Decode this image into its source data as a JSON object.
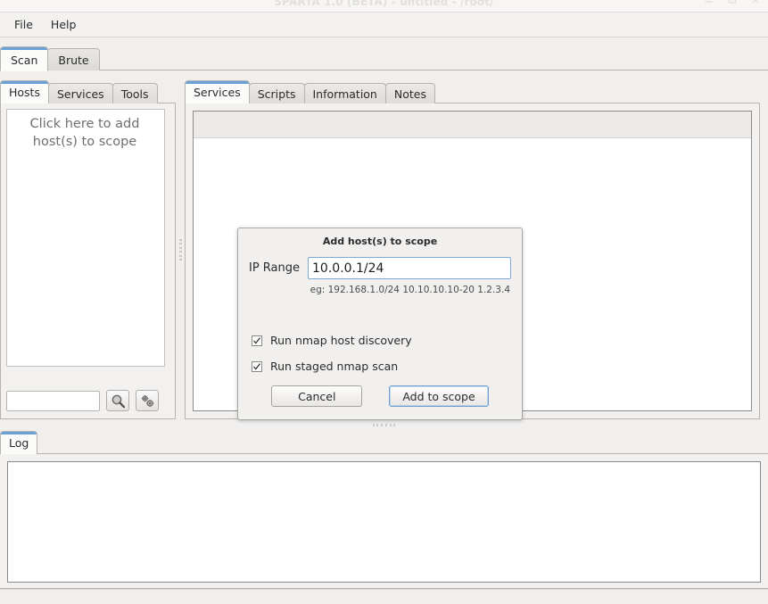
{
  "window": {
    "title": "SPARTA 1.0 (BETA) - untitled - /root/",
    "controls": {
      "minimize": "minimize-icon",
      "maximize": "maximize-icon",
      "close": "close-icon"
    }
  },
  "menubar": {
    "items": [
      {
        "label": "File"
      },
      {
        "label": "Help"
      }
    ]
  },
  "main_tabs": [
    {
      "label": "Scan",
      "active": true
    },
    {
      "label": "Brute",
      "active": false
    }
  ],
  "left_panel": {
    "tabs": [
      {
        "label": "Hosts",
        "active": true
      },
      {
        "label": "Services",
        "active": false
      },
      {
        "label": "Tools",
        "active": false
      }
    ],
    "host_list": {
      "placeholder_line1": "Click here to add",
      "placeholder_line2": "host(s) to scope",
      "items": []
    },
    "search": {
      "value": "",
      "placeholder": "",
      "search_button_icon": "magnifier-icon",
      "settings_button_icon": "gears-icon"
    }
  },
  "right_panel": {
    "tabs": [
      {
        "label": "Services",
        "active": true
      },
      {
        "label": "Scripts",
        "active": false
      },
      {
        "label": "Information",
        "active": false
      },
      {
        "label": "Notes",
        "active": false
      }
    ],
    "table": {
      "columns": [],
      "rows": []
    }
  },
  "dialog": {
    "title": "Add host(s) to scope",
    "ip_range_label": "IP Range",
    "ip_range_value": "10.0.0.1/24",
    "ip_range_placeholder": "",
    "hint": "eg: 192.168.1.0/24 10.10.10.10-20 1.2.3.4",
    "checkboxes": [
      {
        "label": "Run nmap host discovery",
        "checked": true
      },
      {
        "label": "Run staged nmap scan",
        "checked": true
      }
    ],
    "cancel_label": "Cancel",
    "submit_label": "Add to scope"
  },
  "bottom_panel": {
    "tabs": [
      {
        "label": "Log",
        "active": true
      }
    ],
    "log_text": ""
  },
  "statusbar": {
    "text": ""
  },
  "colors": {
    "accent": "#6aa0d8",
    "focus_border": "#7fa9d5",
    "window_bg": "#f0efee",
    "panel_bg": "#f2f1ef",
    "content_bg": "#ffffff",
    "text": "#2e2e2e",
    "placeholder_text": "#6f6f6f",
    "title_text": "#e2e0de"
  }
}
